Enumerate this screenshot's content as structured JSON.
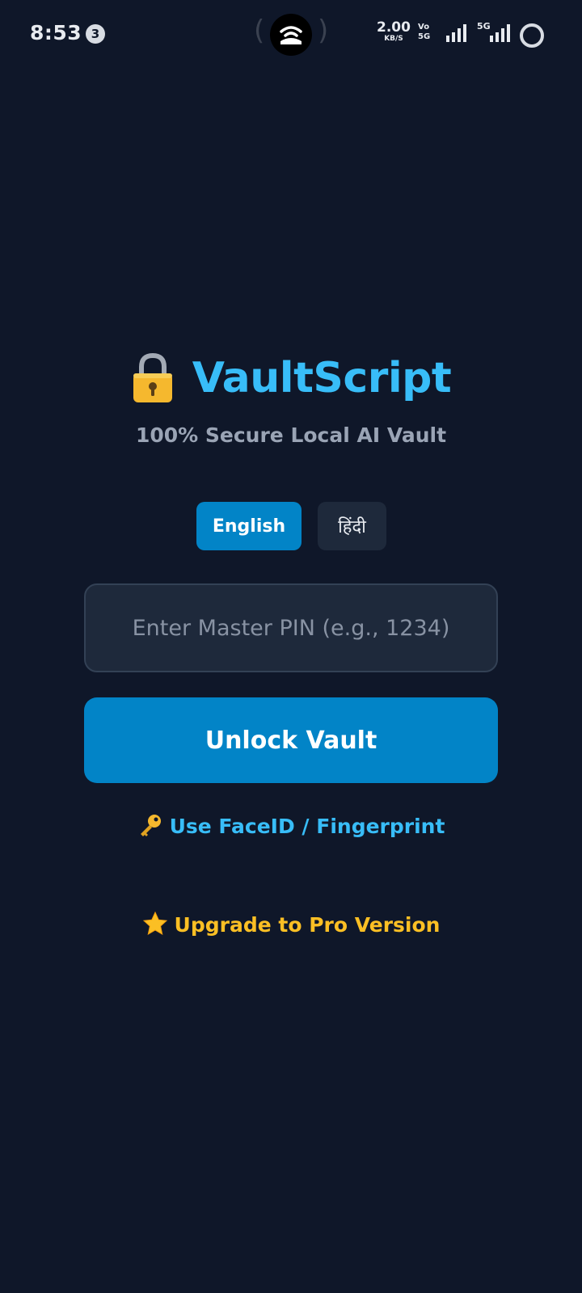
{
  "status_bar": {
    "time": "8:53",
    "notification_count": "3",
    "net_speed": "2.00",
    "net_speed_unit": "KB/S",
    "volte_line1": "Vo",
    "volte_line2": "5G",
    "network_type": "5G"
  },
  "app": {
    "title": "VaultScript",
    "subtitle": "100% Secure Local AI Vault"
  },
  "language": {
    "options": [
      "English",
      "हिंदी"
    ],
    "selected": "English"
  },
  "pin": {
    "placeholder": "Enter Master PIN (e.g., 1234)",
    "value": ""
  },
  "actions": {
    "unlock_label": "Unlock Vault",
    "biometric_label": "Use FaceID / Fingerprint",
    "upgrade_label": "Upgrade to Pro Version"
  },
  "colors": {
    "background": "#0f1729",
    "accent": "#38bdf8",
    "primary_button": "#0284c7",
    "upgrade": "#fbbf24"
  },
  "icons": {
    "brand": "lock-icon",
    "biometric": "key-icon",
    "upgrade": "star-icon"
  }
}
